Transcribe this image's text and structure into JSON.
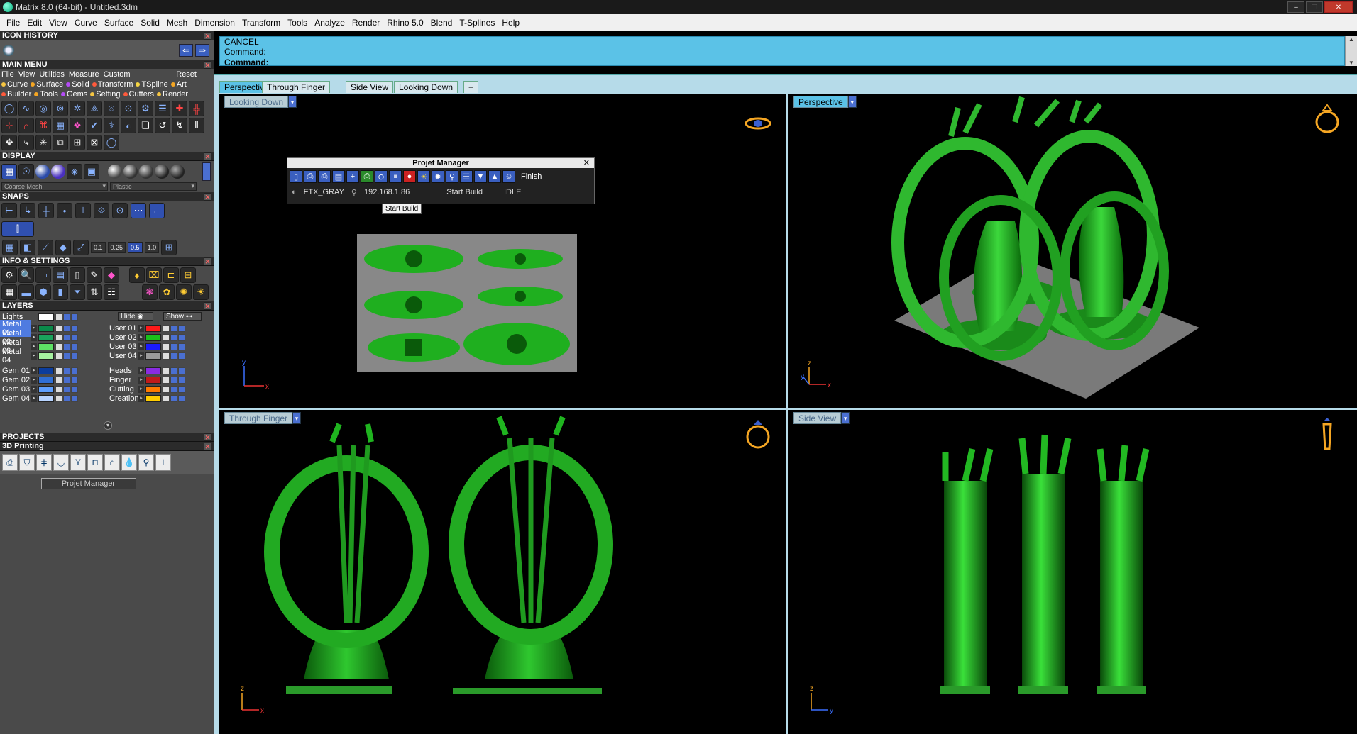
{
  "window": {
    "title": "Matrix 8.0 (64-bit) - Untitled.3dm"
  },
  "menubar": [
    "File",
    "Edit",
    "View",
    "Curve",
    "Surface",
    "Solid",
    "Mesh",
    "Dimension",
    "Transform",
    "Tools",
    "Analyze",
    "Render",
    "Rhino 5.0",
    "Blend",
    "T-Splines",
    "Help"
  ],
  "left_panel": {
    "icon_history": "ICON HISTORY",
    "main_menu": {
      "header": "MAIN MENU",
      "items": [
        "File",
        "View",
        "Utilities",
        "Measure",
        "Custom"
      ],
      "reset": "Reset",
      "categories_row1": [
        {
          "label": "Curve",
          "color": "#f5c542"
        },
        {
          "label": "Surface",
          "color": "#f5a623"
        },
        {
          "label": "Solid",
          "color": "#b44cf5"
        },
        {
          "label": "Transform",
          "color": "#ff5a3c"
        },
        {
          "label": "TSpline",
          "color": "#f5d442"
        },
        {
          "label": "Art",
          "color": "#f5a623"
        }
      ],
      "categories_row2": [
        {
          "label": "Builder",
          "color": "#ff5a3c"
        },
        {
          "label": "Tools",
          "color": "#f5a623"
        },
        {
          "label": "Gems",
          "color": "#b44cf5"
        },
        {
          "label": "Setting",
          "color": "#f5c542"
        },
        {
          "label": "Cutters",
          "color": "#ff5a3c"
        },
        {
          "label": "Render",
          "color": "#f5c542"
        }
      ]
    },
    "display": {
      "header": "DISPLAY",
      "mesh_dropdown": "Coarse Mesh",
      "material_dropdown": "Plastic"
    },
    "snaps": {
      "header": "SNAPS",
      "values": [
        "0.1",
        "0.25",
        "0.5",
        "1.0"
      ],
      "active_value": "0.5"
    },
    "info_settings": {
      "header": "INFO & SETTINGS"
    },
    "layers": {
      "header": "LAYERS",
      "lights": "Lights",
      "hide": "Hide",
      "show": "Show",
      "left_col": [
        {
          "name": "Metal 01",
          "color": "#0b8a4a",
          "selected": true
        },
        {
          "name": "Metal 02",
          "color": "#1aa35c"
        },
        {
          "name": "Metal 03",
          "color": "#5ee065"
        },
        {
          "name": "Metal 04",
          "color": "#a6f0a0"
        },
        {
          "name": "Gem 01",
          "color": "#0b3d9e"
        },
        {
          "name": "Gem 02",
          "color": "#2f6fd6"
        },
        {
          "name": "Gem 03",
          "color": "#5fa0ff"
        },
        {
          "name": "Gem 04",
          "color": "#b8d4ff"
        }
      ],
      "right_col": [
        {
          "name": "User 01",
          "color": "#ff1a1a"
        },
        {
          "name": "User 02",
          "color": "#1ac01a"
        },
        {
          "name": "User 03",
          "color": "#1a1aff"
        },
        {
          "name": "User 04",
          "color": "#9a9a9a"
        },
        {
          "name": "Heads",
          "color": "#8a2be2"
        },
        {
          "name": "Finger",
          "color": "#c01a1a"
        },
        {
          "name": "Cutting",
          "color": "#ff7a00"
        },
        {
          "name": "Creation",
          "color": "#ffcc00"
        }
      ]
    },
    "projects": {
      "header": "PROJECTS"
    },
    "printing": {
      "header": "3D Printing",
      "button": "Projet Manager"
    }
  },
  "command": {
    "line1": "CANCEL",
    "line2": "Command:",
    "line3": "Command:"
  },
  "tabs": [
    "Perspective",
    "Through Finger",
    "Side View",
    "Looking Down"
  ],
  "tab_add": "+",
  "viewports": {
    "top_left": "Looking Down",
    "top_right": "Perspective",
    "bottom_left": "Through Finger",
    "bottom_right": "Side View"
  },
  "axes": {
    "x": "x",
    "y": "y",
    "z": "z"
  },
  "projet_manager": {
    "title": "Projet Manager",
    "close": "✕",
    "finish": "Finish",
    "material": "FTX_GRAY",
    "ip": "192.168.1.86",
    "start_build": "Start Build",
    "status": "IDLE",
    "tooltip": "Start Build"
  },
  "colors": {
    "accent": "#5bc2e7",
    "metal": "#1fa51f"
  }
}
